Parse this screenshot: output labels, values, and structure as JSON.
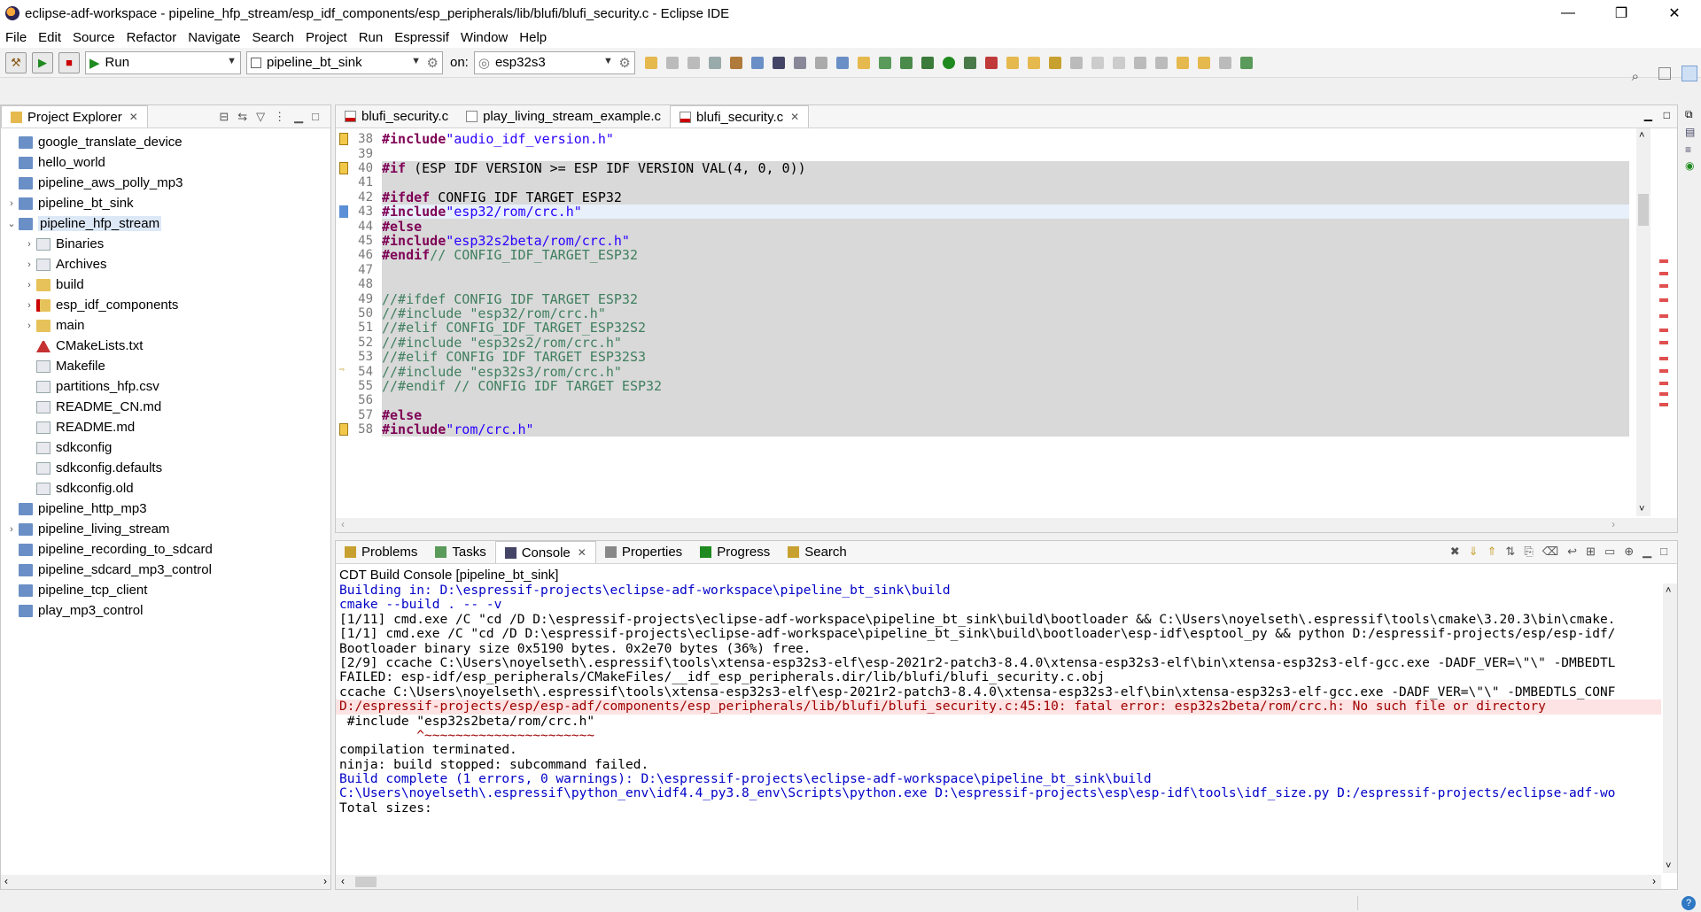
{
  "window": {
    "title": "eclipse-adf-workspace - pipeline_hfp_stream/esp_idf_components/esp_peripherals/lib/blufi/blufi_security.c - Eclipse IDE",
    "minimize": "—",
    "maximize": "❐",
    "close": "✕"
  },
  "menu": [
    "File",
    "Edit",
    "Source",
    "Refactor",
    "Navigate",
    "Search",
    "Project",
    "Run",
    "Espressif",
    "Window",
    "Help"
  ],
  "toolbar": {
    "launch_mode": "Run",
    "launch_config": "pipeline_bt_sink",
    "on_label": "on:",
    "target": "esp32s3"
  },
  "project_explorer": {
    "tab_label": "Project Explorer",
    "items": [
      {
        "label": "google_translate_device",
        "depth": 0,
        "twisty": "",
        "icon": "project"
      },
      {
        "label": "hello_world",
        "depth": 0,
        "twisty": "",
        "icon": "project"
      },
      {
        "label": "pipeline_aws_polly_mp3",
        "depth": 0,
        "twisty": "",
        "icon": "project"
      },
      {
        "label": "pipeline_bt_sink",
        "depth": 0,
        "twisty": ">",
        "icon": "project"
      },
      {
        "label": "pipeline_hfp_stream",
        "depth": 0,
        "twisty": "v",
        "icon": "project",
        "selected": true
      },
      {
        "label": "Binaries",
        "depth": 1,
        "twisty": ">",
        "icon": "binaries"
      },
      {
        "label": "Archives",
        "depth": 1,
        "twisty": ">",
        "icon": "archives"
      },
      {
        "label": "build",
        "depth": 1,
        "twisty": ">",
        "icon": "folder"
      },
      {
        "label": "esp_idf_components",
        "depth": 1,
        "twisty": ">",
        "icon": "folder-error"
      },
      {
        "label": "main",
        "depth": 1,
        "twisty": ">",
        "icon": "folder"
      },
      {
        "label": "CMakeLists.txt",
        "depth": 1,
        "twisty": "",
        "icon": "cmake"
      },
      {
        "label": "Makefile",
        "depth": 1,
        "twisty": "",
        "icon": "file"
      },
      {
        "label": "partitions_hfp.csv",
        "depth": 1,
        "twisty": "",
        "icon": "csv"
      },
      {
        "label": "README_CN.md",
        "depth": 1,
        "twisty": "",
        "icon": "file"
      },
      {
        "label": "README.md",
        "depth": 1,
        "twisty": "",
        "icon": "file"
      },
      {
        "label": "sdkconfig",
        "depth": 1,
        "twisty": "",
        "icon": "file"
      },
      {
        "label": "sdkconfig.defaults",
        "depth": 1,
        "twisty": "",
        "icon": "file"
      },
      {
        "label": "sdkconfig.old",
        "depth": 1,
        "twisty": "",
        "icon": "file"
      },
      {
        "label": "pipeline_http_mp3",
        "depth": 0,
        "twisty": "",
        "icon": "project"
      },
      {
        "label": "pipeline_living_stream",
        "depth": 0,
        "twisty": ">",
        "icon": "project"
      },
      {
        "label": "pipeline_recording_to_sdcard",
        "depth": 0,
        "twisty": "",
        "icon": "project"
      },
      {
        "label": "pipeline_sdcard_mp3_control",
        "depth": 0,
        "twisty": "",
        "icon": "project"
      },
      {
        "label": "pipeline_tcp_client",
        "depth": 0,
        "twisty": "",
        "icon": "project"
      },
      {
        "label": "play_mp3_control",
        "depth": 0,
        "twisty": "",
        "icon": "project"
      }
    ]
  },
  "editor": {
    "tabs": [
      {
        "label": "blufi_security.c",
        "active": false
      },
      {
        "label": "play_living_stream_example.c",
        "active": false
      },
      {
        "label": "blufi_security.c",
        "active": true
      }
    ],
    "lines": [
      {
        "n": "38",
        "text": "#include \"audio_idf_version.h\"",
        "style": "plain",
        "mark": "warn"
      },
      {
        "n": "39",
        "text": "",
        "style": "plain",
        "mark": ""
      },
      {
        "n": "40",
        "text": "#if (ESP_IDF_VERSION >= ESP_IDF_VERSION_VAL(4, 0, 0))",
        "style": "inactive",
        "mark": "warn"
      },
      {
        "n": "41",
        "text": "",
        "style": "inactive",
        "mark": ""
      },
      {
        "n": "42",
        "text": "#ifdef CONFIG_IDF_TARGET_ESP32",
        "style": "inactive",
        "mark": ""
      },
      {
        "n": "43",
        "text": "#include \"esp32/rom/crc.h\"",
        "style": "hl",
        "mark": "blue"
      },
      {
        "n": "44",
        "text": "#else",
        "style": "inactive",
        "mark": ""
      },
      {
        "n": "45",
        "text": "#include \"esp32s2beta/rom/crc.h\"",
        "style": "inactive",
        "mark": ""
      },
      {
        "n": "46",
        "text": "#endif // CONFIG_IDF_TARGET_ESP32",
        "style": "inactive",
        "mark": ""
      },
      {
        "n": "47",
        "text": "",
        "style": "inactive",
        "mark": ""
      },
      {
        "n": "48",
        "text": "",
        "style": "inactive",
        "mark": ""
      },
      {
        "n": "49",
        "text": "//#ifdef CONFIG_IDF_TARGET_ESP32",
        "style": "inactive",
        "mark": ""
      },
      {
        "n": "50",
        "text": "//#include \"esp32/rom/crc.h\"",
        "style": "inactive",
        "mark": ""
      },
      {
        "n": "51",
        "text": "//#elif CONFIG_IDF_TARGET_ESP32S2",
        "style": "inactive",
        "mark": ""
      },
      {
        "n": "52",
        "text": "//#include \"esp32s2/rom/crc.h\"",
        "style": "inactive",
        "mark": ""
      },
      {
        "n": "53",
        "text": "//#elif CONFIG_IDF_TARGET_ESP32S3",
        "style": "inactive",
        "mark": ""
      },
      {
        "n": "54",
        "text": "//#include \"esp32s3/rom/crc.h\"",
        "style": "inactive",
        "mark": "arrow"
      },
      {
        "n": "55",
        "text": "//#endif // CONFIG_IDF_TARGET_ESP32",
        "style": "inactive",
        "mark": ""
      },
      {
        "n": "56",
        "text": "",
        "style": "inactive",
        "mark": ""
      },
      {
        "n": "57",
        "text": "#else",
        "style": "inactive",
        "mark": ""
      },
      {
        "n": "58",
        "text": "#include \"rom/crc.h\"",
        "style": "inactive",
        "mark": "warn"
      }
    ]
  },
  "bottom_panel": {
    "tabs": [
      "Problems",
      "Tasks",
      "Console",
      "Properties",
      "Progress",
      "Search"
    ],
    "active_tab": "Console",
    "console_title": "CDT Build Console [pipeline_bt_sink]",
    "lines": [
      {
        "text": "Building in: D:\\espressif-projects\\eclipse-adf-workspace\\pipeline_bt_sink\\build",
        "style": "blue"
      },
      {
        "text": "cmake --build . -- -v",
        "style": "blue"
      },
      {
        "text": "[1/11] cmd.exe /C \"cd /D D:\\espressif-projects\\eclipse-adf-workspace\\pipeline_bt_sink\\build\\bootloader && C:\\Users\\noyelseth\\.espressif\\tools\\cmake\\3.20.3\\bin\\cmake.",
        "style": "plain"
      },
      {
        "text": "[1/1] cmd.exe /C \"cd /D D:\\espressif-projects\\eclipse-adf-workspace\\pipeline_bt_sink\\build\\bootloader\\esp-idf\\esptool_py && python D:/espressif-projects/esp/esp-idf/",
        "style": "plain"
      },
      {
        "text": "Bootloader binary size 0x5190 bytes. 0x2e70 bytes (36%) free.",
        "style": "plain"
      },
      {
        "text": "[2/9] ccache C:\\Users\\noyelseth\\.espressif\\tools\\xtensa-esp32s3-elf\\esp-2021r2-patch3-8.4.0\\xtensa-esp32s3-elf\\bin\\xtensa-esp32s3-elf-gcc.exe -DADF_VER=\\\"\\\" -DMBEDTL",
        "style": "plain"
      },
      {
        "text": "FAILED: esp-idf/esp_peripherals/CMakeFiles/__idf_esp_peripherals.dir/lib/blufi/blufi_security.c.obj",
        "style": "plain"
      },
      {
        "text": "ccache C:\\Users\\noyelseth\\.espressif\\tools\\xtensa-esp32s3-elf\\esp-2021r2-patch3-8.4.0\\xtensa-esp32s3-elf\\bin\\xtensa-esp32s3-elf-gcc.exe -DADF_VER=\\\"\\\" -DMBEDTLS_CONF",
        "style": "plain"
      },
      {
        "text": "D:/espressif-projects/esp/esp-adf/components/esp_peripherals/lib/blufi/blufi_security.c:45:10: fatal error: esp32s2beta/rom/crc.h: No such file or directory",
        "style": "err"
      },
      {
        "text": " #include \"esp32s2beta/rom/crc.h\"",
        "style": "plain"
      },
      {
        "text": "          ^~~~~~~~~~~~~~~~~~~~~~~",
        "style": "caret-line"
      },
      {
        "text": "compilation terminated.",
        "style": "plain"
      },
      {
        "text": "ninja: build stopped: subcommand failed.",
        "style": "plain"
      },
      {
        "text": "Build complete (1 errors, 0 warnings): D:\\espressif-projects\\eclipse-adf-workspace\\pipeline_bt_sink\\build",
        "style": "blue"
      },
      {
        "text": "C:\\Users\\noyelseth\\.espressif\\python_env\\idf4.4_py3.8_env\\Scripts\\python.exe D:\\espressif-projects\\esp\\esp-idf\\tools\\idf_size.py D:/espressif-projects/eclipse-adf-wo",
        "style": "blue"
      },
      {
        "text": "Total sizes:",
        "style": "plain"
      }
    ]
  },
  "colors": {
    "keyword": "#7f0055",
    "string": "#2a00ff",
    "comment": "#3f7f5f",
    "console_blue": "#0000c8",
    "error_bg": "#fde3e3"
  }
}
